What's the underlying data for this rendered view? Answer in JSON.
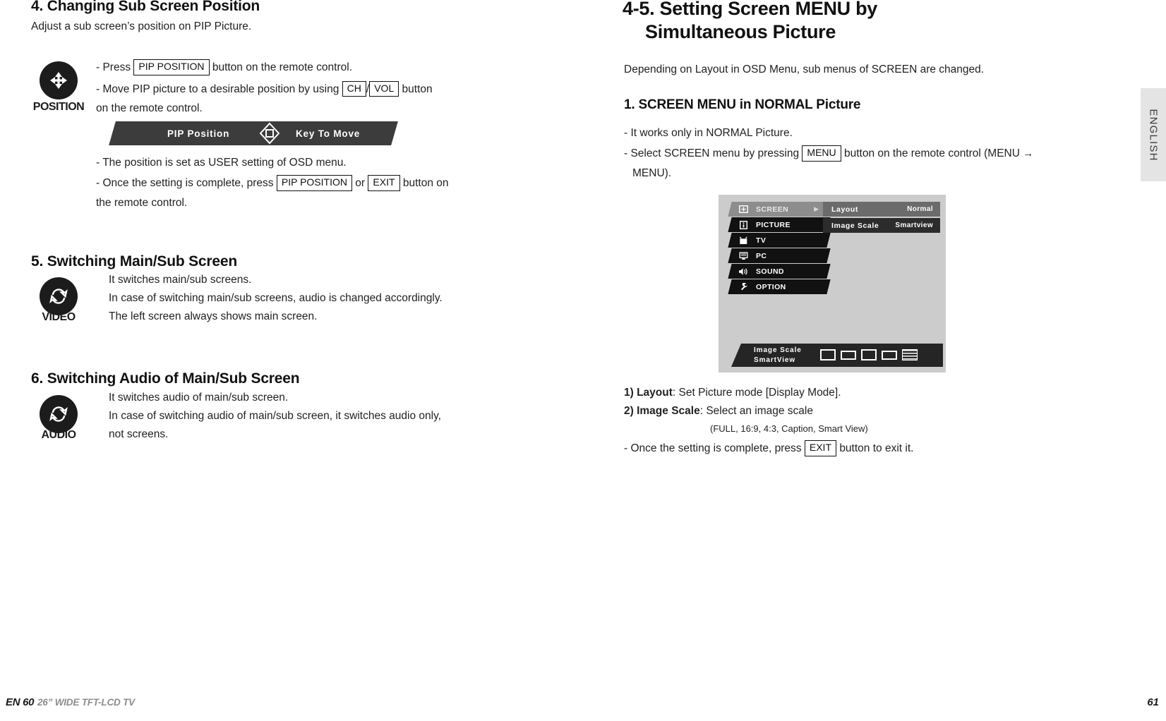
{
  "left_column": {
    "section4": {
      "heading": "4. Changing Sub Screen Position",
      "subtitle": "Adjust a sub screen’s position on PIP Picture.",
      "icon_caption": "POSITION",
      "icon_name": "four-way-arrow-icon",
      "lines": {
        "l1_a": "- Press",
        "l1_key": "PIP POSITION",
        "l1_b": "button on the remote control.",
        "l2_a": "- Move PIP picture to a desirable position by using",
        "l2_key1": "CH",
        "l2_sep": "/",
        "l2_key2": "VOL",
        "l2_b": "button",
        "l3": "on the remote control.",
        "l4": "- The position is set as USER setting of OSD menu.",
        "l5_a": "- Once the setting is complete, press",
        "l5_key1": "PIP POSITION",
        "l5_or": "or",
        "l5_key2": "EXIT",
        "l5_b": "button on",
        "l6": "the remote control."
      },
      "osd_bar": {
        "label_left": "PIP Position",
        "label_right": "Key To Move",
        "icon_name": "dpad-diamond-icon"
      }
    },
    "section5": {
      "heading": "5. Switching Main/Sub Screen",
      "icon_caption": "VIDEO",
      "icon_name": "swap-arrows-icon",
      "lines": [
        "It switches main/sub screens.",
        "In case of switching main/sub screens, audio is changed accordingly.",
        "The left screen always shows main screen."
      ]
    },
    "section6": {
      "heading": "6. Switching Audio of Main/Sub Screen",
      "icon_caption": "AUDIO",
      "icon_name": "swap-arrows-icon",
      "lines": [
        "It switches audio of main/sub screen.",
        "In case of switching audio of main/sub screen, it switches audio only,",
        "not screens."
      ]
    }
  },
  "right_column": {
    "heading_line1": "4-5. Setting Screen MENU by",
    "heading_line2": "Simultaneous Picture",
    "intro": "Depending on Layout in OSD Menu, sub menus of SCREEN are changed.",
    "sub_heading": "1. SCREEN MENU in NORMAL Picture",
    "bullets": {
      "b1": "- It works only in NORMAL Picture.",
      "b2_a": "- Select SCREEN menu by pressing",
      "b2_key": "MENU",
      "b2_b": "button on the remote control (MENU",
      "b2_arrow": "→",
      "b3": "MENU)."
    },
    "notes": {
      "n1_bold": "1) Layout",
      "n1_rest": ": Set Picture mode [Display Mode].",
      "n2_bold": "2) Image Scale",
      "n2_rest": ": Select an image scale",
      "n2_paren": "(FULL, 16:9, 4:3, Caption, Smart View)",
      "n3_a": "- Once the setting is complete, press",
      "n3_key": "EXIT",
      "n3_b": "button to exit it."
    }
  },
  "osd_menu": {
    "left_items": [
      {
        "label": "SCREEN",
        "icon": "screen-icon",
        "selected": true,
        "arrow": "▶"
      },
      {
        "label": "PICTURE",
        "icon": "picture-icon",
        "selected": false,
        "arrow": ""
      },
      {
        "label": "TV",
        "icon": "tv-icon",
        "selected": false,
        "arrow": ""
      },
      {
        "label": "PC",
        "icon": "pc-monitor-icon",
        "selected": false,
        "arrow": ""
      },
      {
        "label": "SOUND",
        "icon": "speaker-icon",
        "selected": false,
        "arrow": ""
      },
      {
        "label": "OPTION",
        "icon": "wrench-icon",
        "selected": false,
        "arrow": ""
      }
    ],
    "right_rows": [
      {
        "key": "Layout",
        "value": "Normal",
        "highlight": true
      },
      {
        "key": "Image Scale",
        "value": "Smartview",
        "highlight": false
      }
    ],
    "bottom_bar": {
      "line1": "Image Scale",
      "line2": "SmartView",
      "scale_icons": [
        "full-scale-icon",
        "16-9-scale-icon",
        "4-3-scale-icon",
        "caption-scale-icon",
        "smartview-scale-icon"
      ]
    }
  },
  "side_tab": {
    "label": "ENGLISH"
  },
  "footer": {
    "page_left": "EN 60",
    "model": "26” WIDE TFT-LCD TV",
    "page_right": "61"
  },
  "colors": {
    "osd_background": "#cccccc",
    "osd_item_dark": "#111111",
    "osd_item_selected": "#8d8d8d",
    "osd_row_highlight": "#6b6b6b",
    "osd_row_dark": "#2c2c2c",
    "icon_badge": "#1c1c1c",
    "side_tab_bg": "#e4e4e4",
    "footer_model": "#8c8c8c"
  }
}
